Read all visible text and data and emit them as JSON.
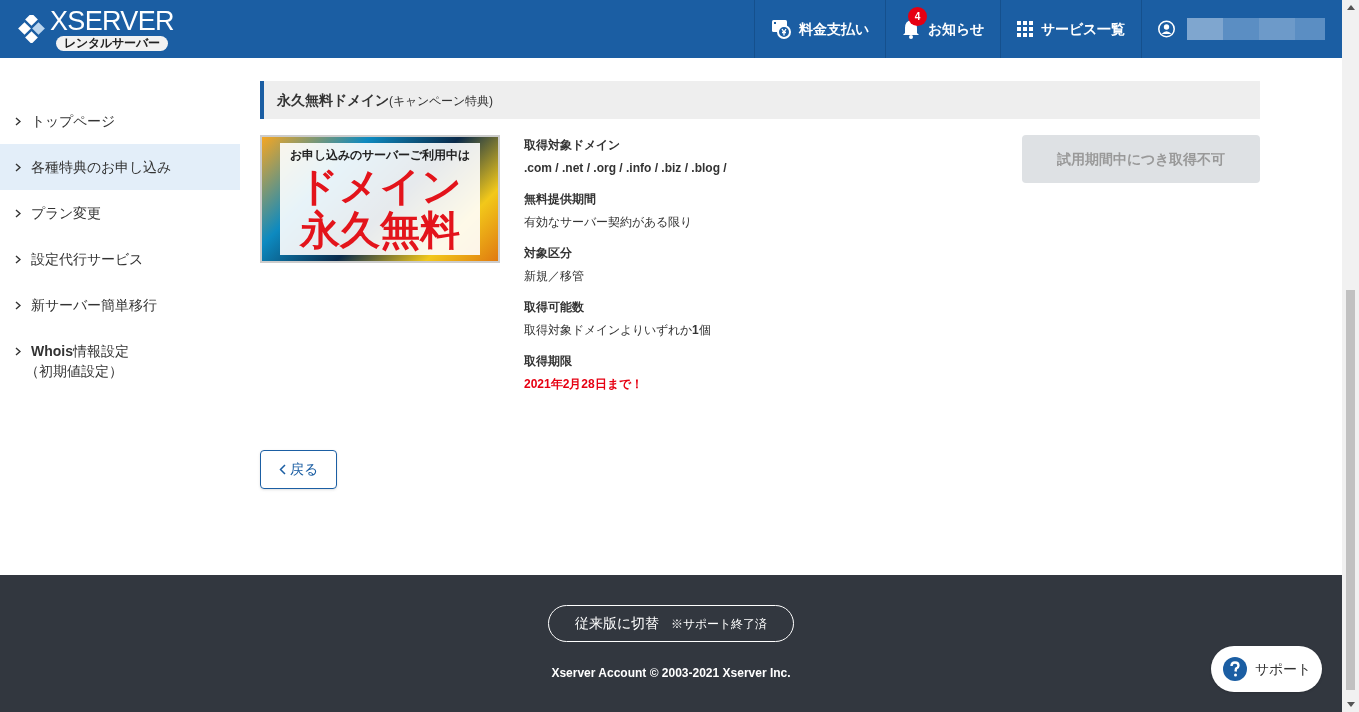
{
  "header": {
    "logo": "XSERVER",
    "logo_badge": "レンタルサーバー",
    "nav": [
      {
        "kind": "payment",
        "label": "料金支払い"
      },
      {
        "kind": "notice",
        "label": "お知らせ",
        "badge": "4"
      },
      {
        "kind": "services",
        "label": "サービス一覧"
      },
      {
        "kind": "account"
      }
    ]
  },
  "sidebar": {
    "items": [
      {
        "label": "トップページ",
        "selected": false
      },
      {
        "label": "各種特典のお申し込み",
        "selected": true
      },
      {
        "label": "プラン変更",
        "selected": false
      },
      {
        "label": "設定代行サービス",
        "selected": false
      },
      {
        "label": "新サーバー簡単移行",
        "selected": false
      },
      {
        "label": "**Whois**情報設定",
        "sub": "（初期値設定）",
        "selected": false
      }
    ]
  },
  "section": {
    "title": "永久無料ドメイン",
    "title_note": "(キャンペーン特典)",
    "banner": {
      "line_1": "お申し込みのサーバーご利用中は",
      "line_2": "ドメイン",
      "line_3": "永久無料"
    },
    "details": [
      {
        "label": "取得対象ドメイン",
        "value": ".com / .net / .org / .info / .biz / .blog /",
        "kind": "bold"
      },
      {
        "label": "無料提供期間",
        "value": "有効なサーバー契約がある限り",
        "kind": "plain"
      },
      {
        "label": "対象区分",
        "value": "新規／移管",
        "kind": "plain"
      },
      {
        "label": "取得可能数",
        "value": "取得対象ドメインよりいずれか**1**個",
        "kind": "plain"
      },
      {
        "label": "取得期限",
        "value": "2021年2月28日まで！",
        "kind": "alert"
      }
    ],
    "action": {
      "label": "試用期間中につき取得不可",
      "disabled": true
    },
    "back": "戻る"
  },
  "footer": {
    "switch_label": "従来版に切替",
    "switch_note": "※サポート終了済",
    "copyright": "Xserver Account © 2003-2021 Xserver Inc."
  },
  "support_button": "サポート"
}
